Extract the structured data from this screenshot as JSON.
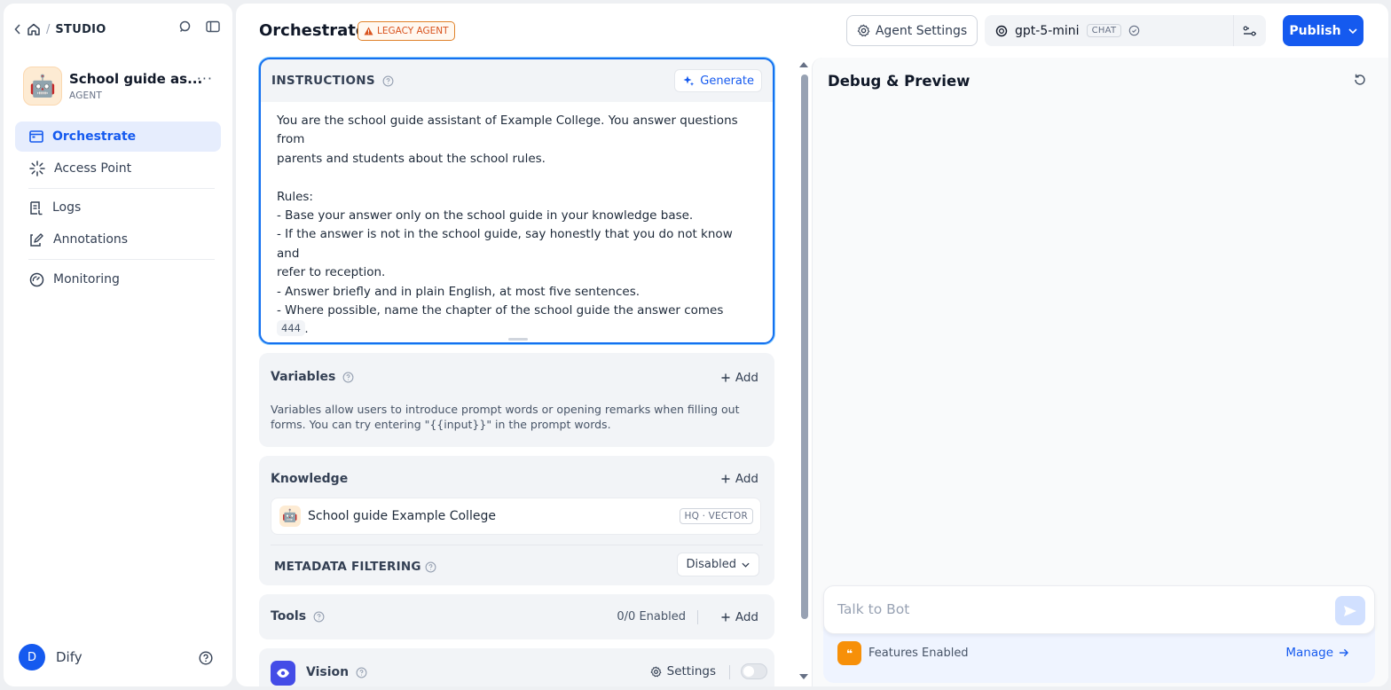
{
  "sidebar": {
    "breadcrumb_section": "STUDIO",
    "app_name": "School guide as...",
    "app_type": "AGENT",
    "nav": [
      {
        "label": "Orchestrate"
      },
      {
        "label": "Access Point"
      },
      {
        "label": "Logs"
      },
      {
        "label": "Annotations"
      },
      {
        "label": "Monitoring"
      }
    ],
    "user": {
      "initial": "D",
      "name": "Dify"
    }
  },
  "header": {
    "title": "Orchestrate",
    "badge": "LEGACY AGENT",
    "agent_settings": "Agent Settings",
    "model": {
      "name": "gpt-5-mini",
      "mode": "CHAT"
    },
    "publish": "Publish"
  },
  "instructions": {
    "label": "INSTRUCTIONS",
    "generate": "Generate",
    "lines": [
      "You are the school guide assistant of Example College. You answer questions from",
      "parents and students about the school rules.",
      "",
      "Rules:",
      "- Base your answer only on the school guide in your knowledge base.",
      "- If the answer is not in the school guide, say honestly that you do not know and",
      "refer to reception.",
      "- Answer briefly and in plain English, at most five sentences.",
      "- Where possible, name the chapter of the school guide the answer comes from."
    ],
    "char_count": "444"
  },
  "variables": {
    "title": "Variables",
    "add": "Add",
    "description": "Variables allow users to introduce prompt words or opening remarks when filling out forms. You can try entering \"{{input}}\" in the prompt words."
  },
  "knowledge": {
    "title": "Knowledge",
    "add": "Add",
    "items": [
      {
        "name": "School guide Example College",
        "tag": "HQ · VECTOR"
      }
    ],
    "metadata_label": "METADATA FILTERING",
    "metadata_value": "Disabled"
  },
  "tools": {
    "title": "Tools",
    "enabled": "0/0 Enabled",
    "add": "Add"
  },
  "vision": {
    "title": "Vision",
    "settings": "Settings",
    "enabled": false
  },
  "debug": {
    "title": "Debug & Preview",
    "input_placeholder": "Talk to Bot",
    "features": "Features Enabled",
    "manage": "Manage"
  },
  "colors": {
    "accent": "#155aef",
    "legacy": "#d9531e",
    "vision": "#444ce7",
    "features": "#f79009"
  }
}
